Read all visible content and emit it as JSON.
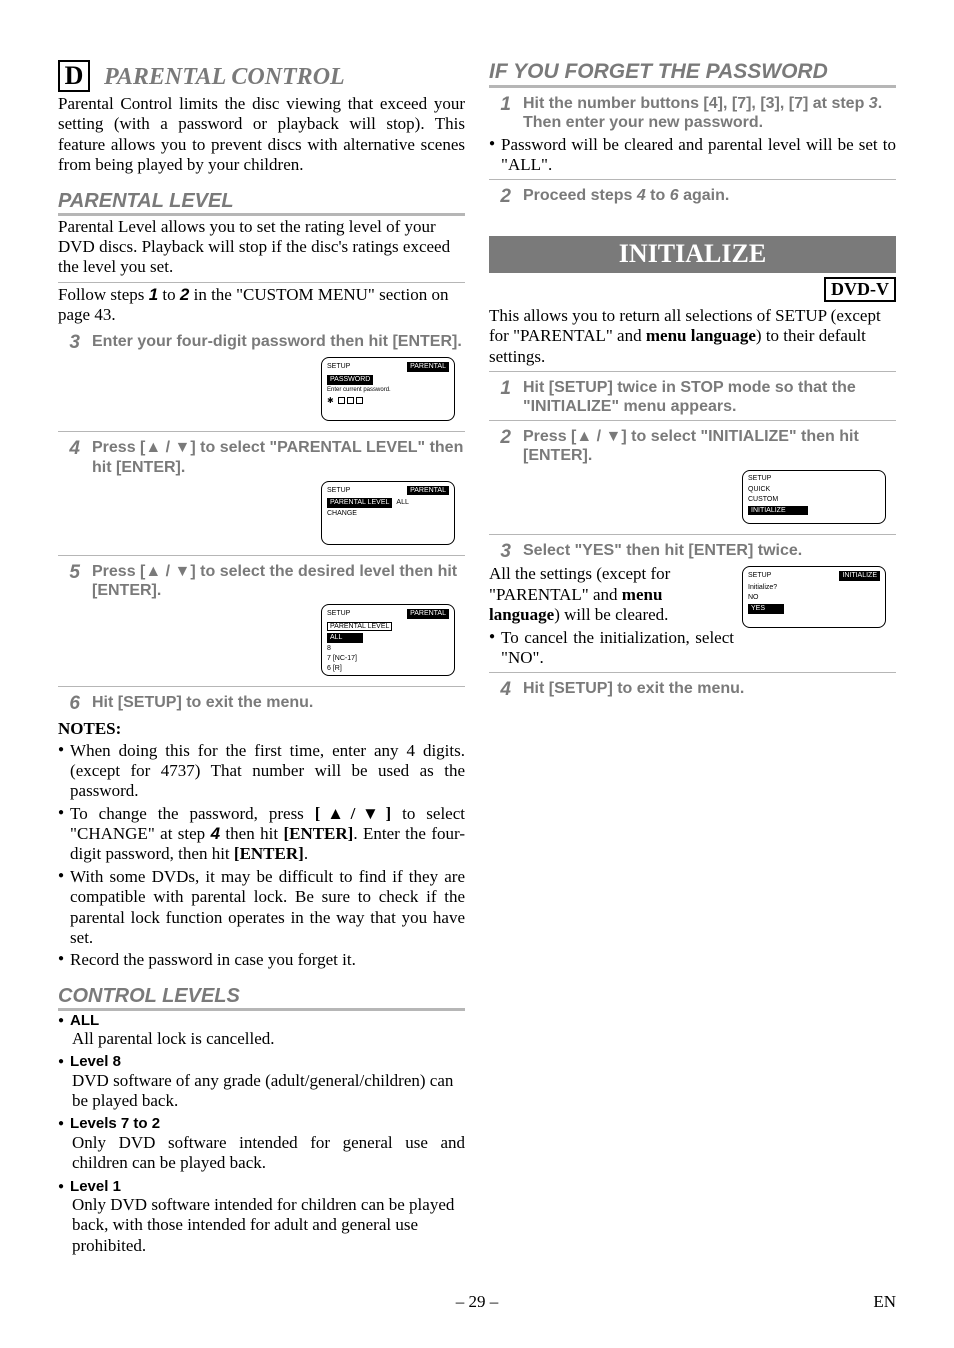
{
  "left": {
    "letter": "D",
    "title": "PARENTAL CONTROL",
    "intro": "Parental Control limits the disc viewing that exceed your setting (with a password or playback will stop). This feature allows you to prevent discs with alternative scenes from being played by your children.",
    "parental_level": {
      "heading": "PARENTAL LEVEL",
      "text": "Parental Level allows you to set the rating level of your DVD discs. Playback will stop if the disc's ratings exceed the level you set.",
      "follow_pre": "Follow steps ",
      "follow_1": "1",
      "follow_mid": " to ",
      "follow_2": "2",
      "follow_post": " in the \"CUSTOM MENU\" section on page 43."
    },
    "steps": {
      "s3": {
        "n": "3",
        "t": "Enter your four-digit password then hit [ENTER]."
      },
      "s4": {
        "n": "4",
        "t": "Press [▲ / ▼] to select \"PARENTAL LEVEL\" then hit [ENTER]."
      },
      "s5": {
        "n": "5",
        "t": "Press [▲ / ▼] to select the desired level then hit [ENTER]."
      },
      "s6": {
        "n": "6",
        "t": "Hit [SETUP] to exit the menu."
      }
    },
    "osd1": {
      "setup": "SETUP",
      "parental": "PARENTAL",
      "password": "PASSWORD",
      "enter_line": "Enter current password."
    },
    "osd2": {
      "setup": "SETUP",
      "parental": "PARENTAL",
      "pl": "PARENTAL LEVEL",
      "change": "CHANGE",
      "all": "ALL"
    },
    "osd3": {
      "setup": "SETUP",
      "parental": "PARENTAL",
      "pl": "PARENTAL LEVEL",
      "all": "ALL",
      "l8": "8",
      "l7": "7 [NC-17]",
      "l6": "6 [R]"
    },
    "notes": {
      "head": "NOTES:",
      "n1": "When doing this for the first time, enter any 4 digits. (except for 4737) That number will be used as the password.",
      "n2_pre": "To change the password, press ",
      "n2_brk": "[▲/▼]",
      "n2_mid1": " to select \"CHANGE\" at step ",
      "n2_step": "4",
      "n2_mid2": " then hit ",
      "n2_enter1": "[ENTER]",
      "n2_mid3": ". Enter the four-digit password, then hit ",
      "n2_enter2": "[ENTER]",
      "n2_post": ".",
      "n3": "With some DVDs, it may be difficult to find if they are compatible with parental lock. Be sure to check if the parental lock function operates in the way that you have set.",
      "n4": "Record the password in case you forget it."
    },
    "control_levels": {
      "heading": "CONTROL LEVELS",
      "all_name": "ALL",
      "all_desc": "All parental lock is cancelled.",
      "l8_name": "Level 8",
      "l8_desc": "DVD software of any grade (adult/general/children) can be played back.",
      "l72_name": "Levels 7 to 2",
      "l72_desc": "Only DVD software intended for general use and children can be played back.",
      "l1_name": "Level 1",
      "l1_desc": "Only DVD software intended for children can be played back, with those intended for adult and general use prohibited."
    }
  },
  "right": {
    "forgot_heading": "IF YOU FORGET THE PASSWORD",
    "f_step1_n": "1",
    "f_step1_pre": "Hit the number buttons [4], [7], [3], [7] at step ",
    "f_step1_step": "3",
    "f_step1_post": ". Then enter your new password.",
    "f_bullet": "Password will be cleared and parental level will be set to \"ALL\".",
    "f_step2_n": "2",
    "f_step2_pre": "Proceed steps ",
    "f_step2_a": "4",
    "f_step2_mid": " to ",
    "f_step2_b": "6",
    "f_step2_post": " again.",
    "init_banner": "INITIALIZE",
    "dvd_badge": "DVD-V",
    "init_intro_pre": "This allows you to return all selections of SETUP (except for \"PARENTAL\" and ",
    "init_intro_bold": "menu language",
    "init_intro_post": ") to their default settings.",
    "i_step1_n": "1",
    "i_step1_t": "Hit [SETUP] twice in STOP mode so that the \"INITIALIZE\" menu appears.",
    "i_step2_n": "2",
    "i_step2_t": "Press [▲ / ▼] to select \"INITIALIZE\" then hit [ENTER].",
    "osd_init1": {
      "setup": "SETUP",
      "quick": "QUICK",
      "custom": "CUSTOM",
      "init": "INITIALIZE"
    },
    "i_step3_n": "3",
    "i_step3_t": "Select \"YES\" then hit [ENTER] twice.",
    "i_step3_body_pre": "All the settings (except for \"PARENTAL\" and ",
    "i_step3_body_bold": "menu language",
    "i_step3_body_post": ") will be cleared.",
    "i_step3_bullet": "To cancel the initialization, select \"NO\".",
    "osd_init2": {
      "setup": "SETUP",
      "init": "INITIALIZE",
      "q": "Initialize?",
      "no": "NO",
      "yes": "YES"
    },
    "i_step4_n": "4",
    "i_step4_t": "Hit [SETUP] to exit the menu."
  },
  "footer": {
    "page": "– 29 –",
    "lang": "EN"
  }
}
